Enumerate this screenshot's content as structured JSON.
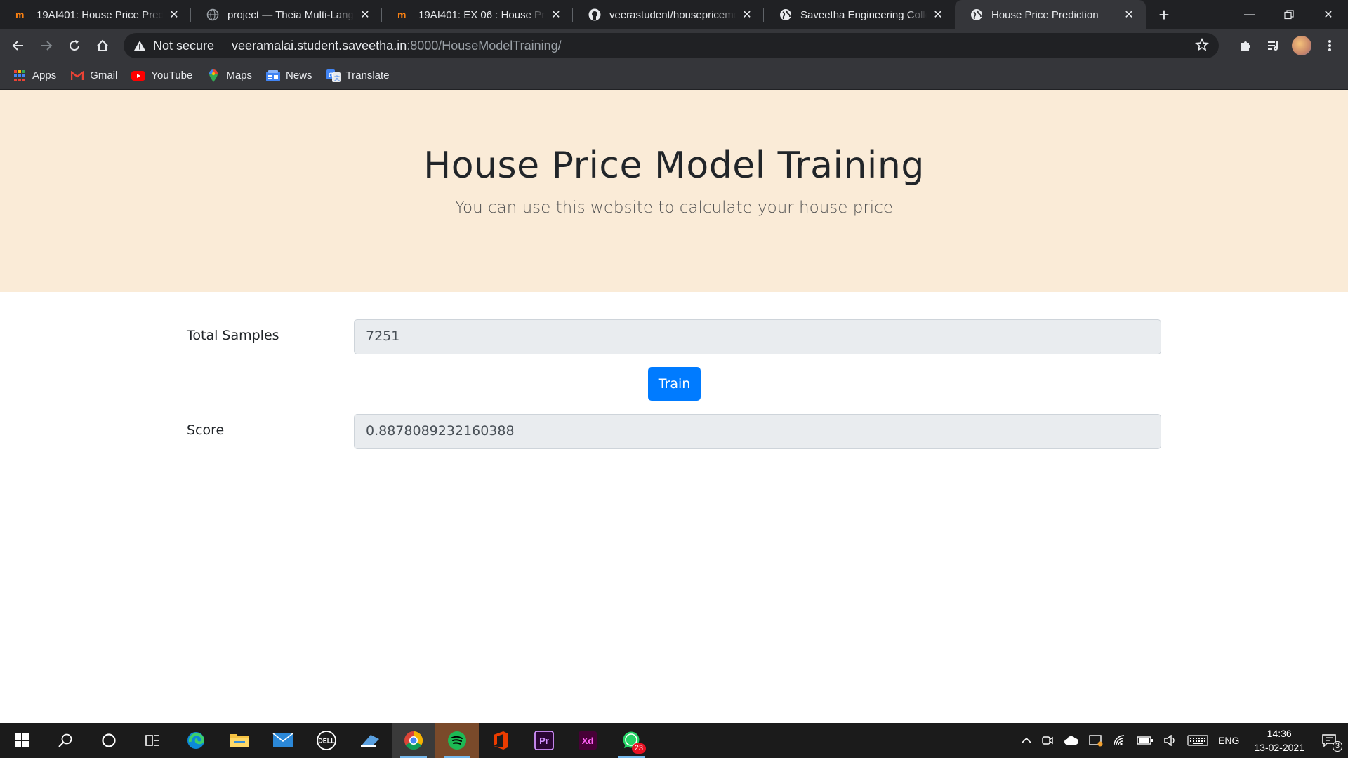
{
  "browser": {
    "tabs": [
      {
        "title": "19AI401: House Price Predicti",
        "icon": "moodle-icon",
        "active": false
      },
      {
        "title": "project — Theia Multi-Langu",
        "icon": "globe-icon",
        "active": false
      },
      {
        "title": "19AI401: EX 06 : House Price",
        "icon": "moodle-icon",
        "active": false
      },
      {
        "title": "veerastudent/housepricemo",
        "icon": "github-icon",
        "active": false
      },
      {
        "title": "Saveetha Engineering Colleg",
        "icon": "globe-icon",
        "active": false
      },
      {
        "title": "House Price Prediction",
        "icon": "globe-icon",
        "active": true
      }
    ],
    "address": {
      "security": "Not secure",
      "host": "veeramalai.student.saveetha.in",
      "path": ":8000/HouseModelTraining/"
    },
    "bookmarks": [
      {
        "label": "Apps",
        "icon": "apps-grid-icon"
      },
      {
        "label": "Gmail",
        "icon": "gmail-icon"
      },
      {
        "label": "YouTube",
        "icon": "youtube-icon"
      },
      {
        "label": "Maps",
        "icon": "maps-icon"
      },
      {
        "label": "News",
        "icon": "news-icon"
      },
      {
        "label": "Translate",
        "icon": "translate-icon"
      }
    ]
  },
  "page": {
    "title": "House Price Model Training",
    "subtitle": "You can use this website to calculate your house price",
    "form": {
      "samples_label": "Total Samples",
      "samples_value": "7251",
      "train_label": "Train",
      "score_label": "Score",
      "score_value": "0.8878089232160388"
    }
  },
  "taskbar": {
    "whatsapp_badge": "23",
    "language": "ENG",
    "time": "14:36",
    "date": "13-02-2021",
    "notifications": "3"
  },
  "colors": {
    "hero_bg": "#faebd7",
    "button": "#007bff",
    "chrome_dark": "#202124",
    "chrome_toolbar": "#35363a"
  }
}
